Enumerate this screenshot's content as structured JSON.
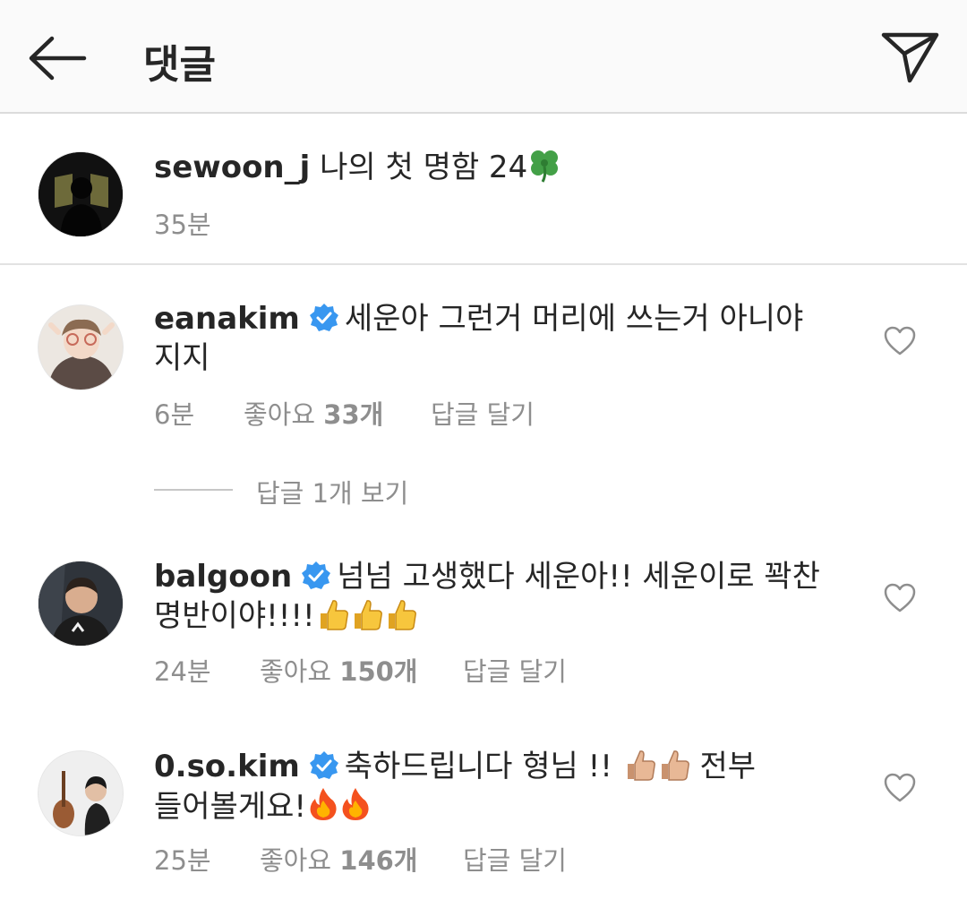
{
  "header": {
    "title": "댓글",
    "back_icon": "arrow-left-icon",
    "send_icon": "paper-plane-icon"
  },
  "caption": {
    "username": "sewoon_j",
    "text": "나의 첫 명함 24",
    "emoji": "four-leaf-clover",
    "time": "35분"
  },
  "comments": [
    {
      "username": "eanakim",
      "verified": true,
      "line1": "세운아 그런거 머리에 쓰는거 아니야",
      "line2": "지지",
      "time": "6분",
      "likes_label": "좋아요",
      "likes_count": "33개",
      "reply_label": "답글 달기"
    },
    {
      "username": "balgoon",
      "verified": true,
      "line1": "넘넘 고생했다 세운아!! 세운이로 꽉찬",
      "line2": "명반이야!!!!",
      "time": "24분",
      "likes_label": "좋아요",
      "likes_count": "150개",
      "reply_label": "답글 달기"
    },
    {
      "username": "0.so.kim",
      "verified": true,
      "line1": "축하드립니다 형님 !!",
      "line1_tail": "전부",
      "line2": "들어볼게요!",
      "time": "25분",
      "likes_label": "좋아요",
      "likes_count": "146개",
      "reply_label": "답글 달기"
    }
  ],
  "view_replies": "답글 1개 보기",
  "colors": {
    "verified_blue": "#3897f0",
    "meta_gray": "#8e8e8e",
    "header_bg": "#fafafa"
  }
}
